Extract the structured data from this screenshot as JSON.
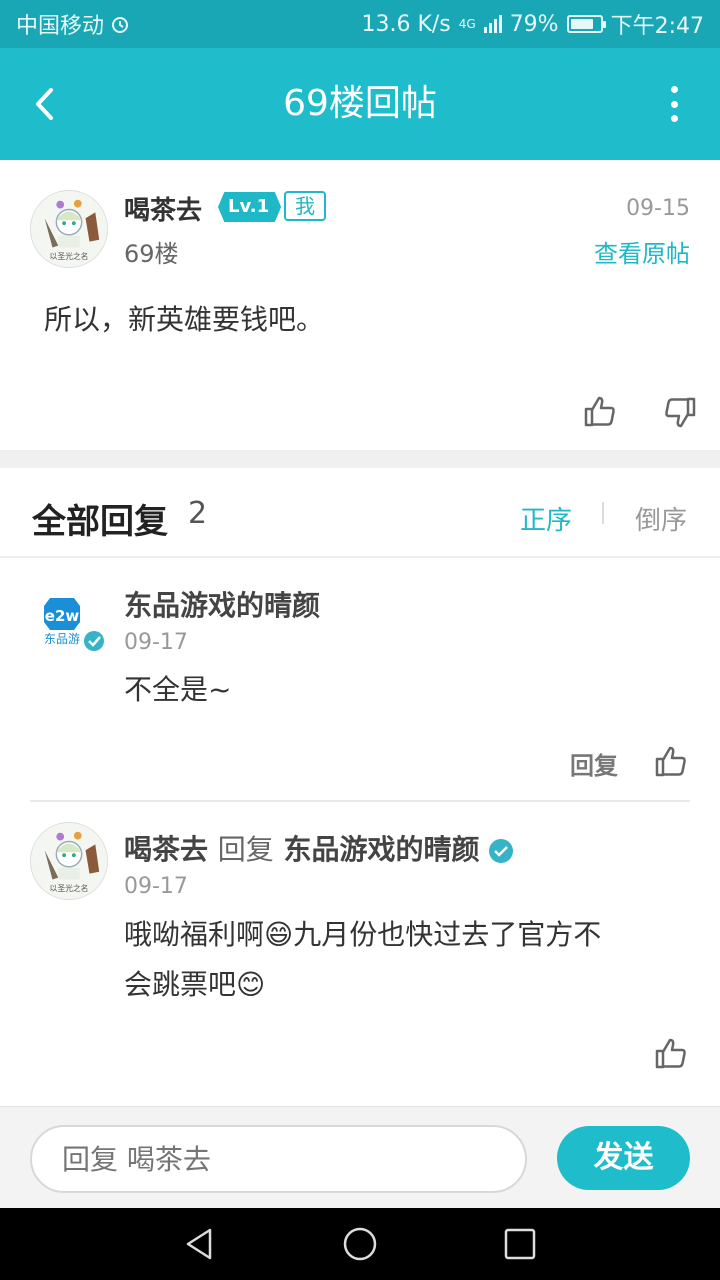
{
  "status_bar": {
    "carrier": "中国移动",
    "speed": "13.6 K/s",
    "network": "4G",
    "battery": "79%",
    "battery_level": 0.79,
    "time": "下午2:47"
  },
  "header": {
    "title": "69楼回帖"
  },
  "post": {
    "author": "喝茶去",
    "level": "Lv.1",
    "me_tag": "我",
    "date": "09-15",
    "floor": "69楼",
    "view_original": "查看原帖",
    "content": "所以，新英雄要钱吧。",
    "avatar_text": "以圣光之名"
  },
  "replies_header": {
    "label": "全部回复",
    "count": "2",
    "order_asc": "正序",
    "order_desc": "倒序"
  },
  "replies": [
    {
      "author": "东品游戏的晴颜",
      "date": "09-17",
      "text": "不全是~",
      "reply_label": "回复",
      "logo_text": "东品游",
      "logo_mark": "e2w"
    },
    {
      "author": "喝茶去",
      "reply_word": "回复",
      "target": "东品游戏的晴颜",
      "date": "09-17",
      "line1": "哦呦福利啊😄九月份也快过去了官方不",
      "line2": "会跳票吧😊",
      "avatar_text": "以圣光之名"
    }
  ],
  "input": {
    "placeholder": "回复 喝茶去",
    "send_label": "发送"
  },
  "colors": {
    "accent": "#1fbccb",
    "status_bar": "#1aa7b5"
  }
}
